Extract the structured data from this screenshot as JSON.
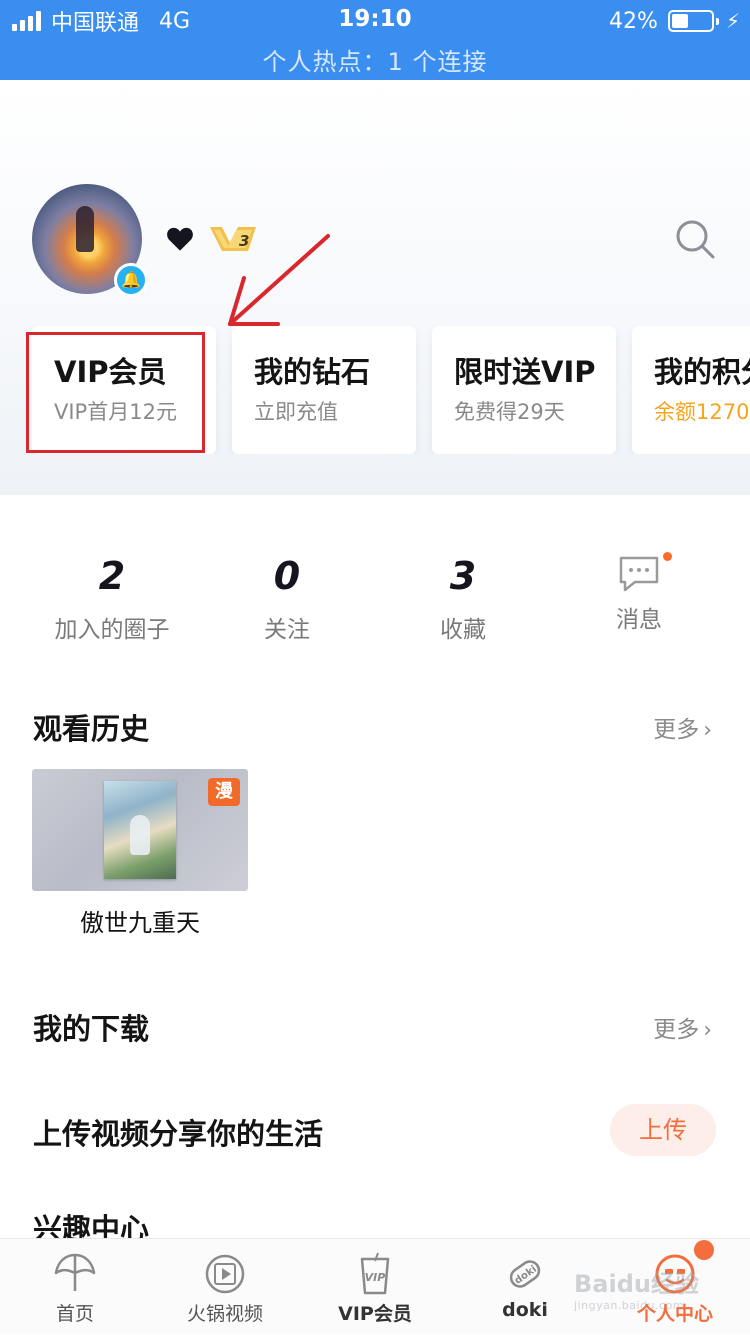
{
  "status_bar": {
    "carrier": "中国联通",
    "network": "4G",
    "time": "19:10",
    "battery": "42%",
    "battery_level": 0.42,
    "hotspot": "个人热点：1 个连接"
  },
  "profile": {
    "vip_level_badge": "3",
    "heart_icon": "heart-icon",
    "search_icon": "search-icon"
  },
  "cards": [
    {
      "title": "VIP会员",
      "subtitle": "VIP首月12元"
    },
    {
      "title": "我的钻石",
      "subtitle": "立即充值"
    },
    {
      "title": "限时送VIP",
      "subtitle": "免费得29天"
    },
    {
      "title": "我的积分",
      "subtitle": "余额1270"
    }
  ],
  "stats": [
    {
      "count": "2",
      "label": "加入的圈子"
    },
    {
      "count": "0",
      "label": "关注"
    },
    {
      "count": "3",
      "label": "收藏"
    },
    {
      "label": "消息"
    }
  ],
  "history": {
    "title": "观看历史",
    "more": "更多",
    "items": [
      {
        "name": "傲世九重天",
        "badge": "漫"
      }
    ]
  },
  "downloads": {
    "title": "我的下载",
    "more": "更多"
  },
  "upload": {
    "title": "上传视频分享你的生活",
    "button": "上传"
  },
  "interest": {
    "title": "兴趣中心"
  },
  "tabs": [
    {
      "label": "首页"
    },
    {
      "label": "火锅视频"
    },
    {
      "label": "VIP会员",
      "icon_text": "VIP"
    },
    {
      "label": "doki",
      "icon_text": "doki"
    },
    {
      "label": "个人中心"
    }
  ],
  "watermark": {
    "logo": "Baidu经验",
    "url": "jingyan.baidu.com"
  },
  "colors": {
    "status_bar": "#3a8ef0",
    "accent": "#f46d3c",
    "highlight_box": "#d9272e",
    "gold": "#f4a51b"
  }
}
